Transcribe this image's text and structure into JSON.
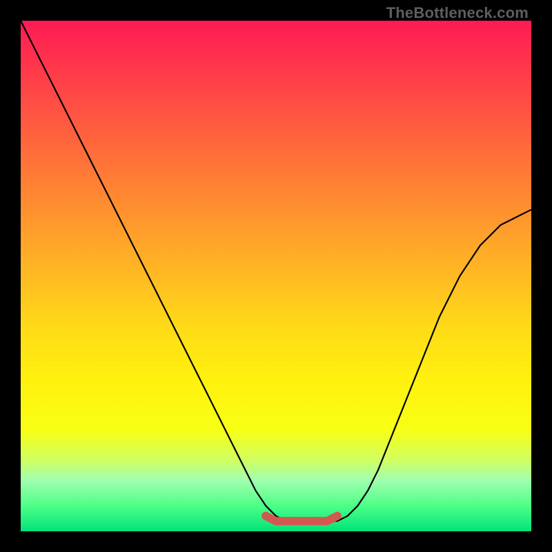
{
  "watermark": "TheBottleneck.com",
  "chart_data": {
    "type": "line",
    "title": "",
    "xlabel": "",
    "ylabel": "",
    "xlim": [
      0,
      100
    ],
    "ylim": [
      0,
      100
    ],
    "series": [
      {
        "name": "curve",
        "x": [
          0,
          2,
          4,
          6,
          8,
          10,
          12,
          14,
          16,
          18,
          20,
          22,
          24,
          26,
          28,
          30,
          32,
          34,
          36,
          38,
          40,
          42,
          44,
          46,
          48,
          50,
          52,
          54,
          56,
          58,
          60,
          62,
          64,
          66,
          68,
          70,
          72,
          74,
          76,
          78,
          80,
          82,
          84,
          86,
          88,
          90,
          92,
          94,
          96,
          98,
          100
        ],
        "values": [
          100,
          96,
          92,
          88,
          84,
          80,
          76,
          72,
          68,
          64,
          60,
          56,
          52,
          48,
          44,
          40,
          36,
          32,
          28,
          24,
          20,
          16,
          12,
          8,
          5,
          3,
          2,
          2,
          2,
          2,
          2,
          2,
          3,
          5,
          8,
          12,
          17,
          22,
          27,
          32,
          37,
          42,
          46,
          50,
          53,
          56,
          58,
          60,
          61,
          62,
          63
        ]
      },
      {
        "name": "highlight",
        "x": [
          48,
          50,
          52,
          54,
          56,
          58,
          60,
          62
        ],
        "values": [
          3,
          2,
          2,
          2,
          2,
          2,
          2,
          3
        ]
      }
    ],
    "colors": {
      "curve": "#000000",
      "highlight": "#d1594f"
    }
  }
}
